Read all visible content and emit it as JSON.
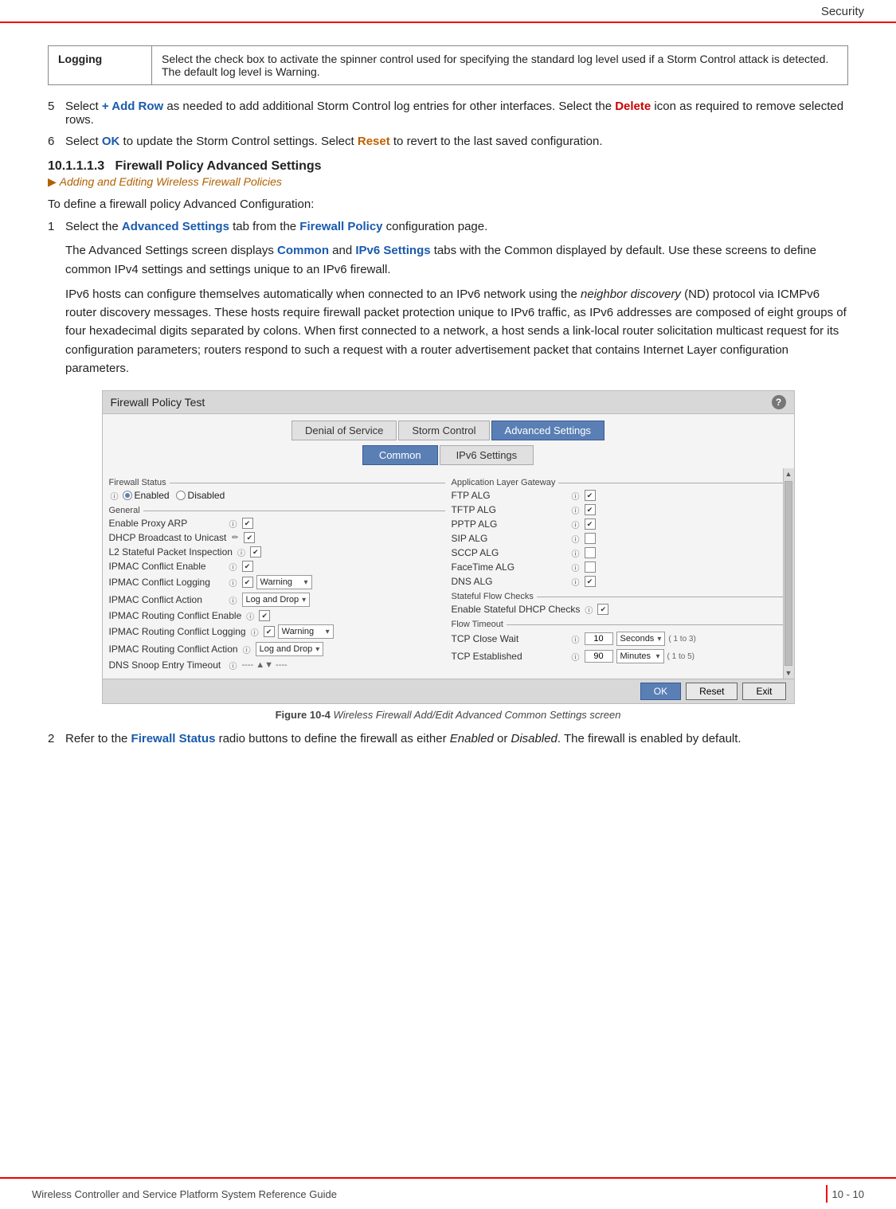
{
  "header": {
    "title": "Security"
  },
  "logging_row": {
    "label": "Logging",
    "description": "Select the check box to activate the spinner control used for specifying the standard log level used if a Storm Control attack is detected. The default log level is Warning."
  },
  "steps": [
    {
      "num": "5",
      "text_parts": [
        {
          "text": "Select ",
          "style": "normal"
        },
        {
          "text": "+ Add Row",
          "style": "blue"
        },
        {
          "text": " as needed to add additional Storm Control log entries for other interfaces. Select the ",
          "style": "normal"
        },
        {
          "text": "Delete",
          "style": "red"
        },
        {
          "text": " icon as required to remove selected rows.",
          "style": "normal"
        }
      ]
    },
    {
      "num": "6",
      "text_parts": [
        {
          "text": "Select ",
          "style": "normal"
        },
        {
          "text": "OK",
          "style": "blue"
        },
        {
          "text": " to update the Storm Control settings. Select ",
          "style": "normal"
        },
        {
          "text": "Reset",
          "style": "orange"
        },
        {
          "text": " to revert to the last saved configuration.",
          "style": "normal"
        }
      ]
    }
  ],
  "section": {
    "number": "10.1.1.1.3",
    "title": "Firewall Policy Advanced Settings",
    "link": "Adding and Editing Wireless Firewall Policies"
  },
  "intro_text": "To define a firewall policy Advanced Configuration:",
  "step1_intro": {
    "num": "1",
    "text_parts": [
      {
        "text": "Select the ",
        "style": "normal"
      },
      {
        "text": "Advanced Settings",
        "style": "blue"
      },
      {
        "text": " tab from the ",
        "style": "normal"
      },
      {
        "text": "Firewall Policy",
        "style": "blue"
      },
      {
        "text": " configuration page.",
        "style": "normal"
      }
    ]
  },
  "para1": "The Advanced Settings screen displays Common and IPv6 Settings tabs with the Common displayed by default. Use these screens to define common IPv4 settings and settings unique to an IPv6 firewall.",
  "para1_highlights": [
    {
      "text": "Common",
      "style": "blue"
    },
    {
      "text": "IPv6 Settings",
      "style": "blue"
    }
  ],
  "para2": "IPv6 hosts can configure themselves automatically when connected to an IPv6 network using the neighbor discovery (ND) protocol via ICMPv6 router discovery messages. These hosts require firewall packet protection unique to IPv6 traffic, as IPv6 addresses are composed of eight groups of four hexadecimal digits separated by colons. When first connected to a network, a host sends a link-local router solicitation multicast request for its configuration parameters; routers respond to such a request with a router advertisement packet that contains Internet Layer configuration parameters.",
  "screenshot": {
    "title": "Firewall Policy  Test",
    "tabs": [
      "Denial of Service",
      "Storm Control",
      "Advanced Settings"
    ],
    "active_tab": "Advanced Settings",
    "subtabs": [
      "Common",
      "IPv6 Settings"
    ],
    "active_subtab": "Common",
    "left_column": {
      "firewall_status_label": "Firewall Status",
      "enabled_label": "Enabled",
      "disabled_label": "Disabled",
      "general_label": "General",
      "fields": [
        {
          "label": "Enable Proxy ARP",
          "has_icon": true,
          "checked": true
        },
        {
          "label": "DHCP Broadcast to Unicast",
          "has_icon": true,
          "checked": true
        },
        {
          "label": "L2 Stateful Packet Inspection",
          "has_icon": true,
          "checked": true
        },
        {
          "label": "IPMAC Conflict Enable",
          "has_icon": true,
          "checked": true
        },
        {
          "label": "IPMAC Conflict Logging",
          "has_icon": true,
          "checked": true,
          "dropdown": "Warning"
        },
        {
          "label": "IPMAC Conflict Action",
          "has_icon": true,
          "dropdown": "Log and Drop"
        },
        {
          "label": "IPMAC Routing Conflict Enable",
          "has_icon": true,
          "checked": true
        },
        {
          "label": "IPMAC Routing Conflict Logging",
          "has_icon": true,
          "checked": true,
          "dropdown": "Warning"
        },
        {
          "label": "IPMAC Routing Conflict Action",
          "has_icon": true,
          "dropdown": "Log and Drop"
        },
        {
          "label": "DNS Snoop Entry Timeout",
          "has_icon": true,
          "has_spinners": true
        }
      ]
    },
    "right_column": {
      "alg_label": "Application Layer Gateway",
      "alg_fields": [
        {
          "label": "FTP ALG",
          "has_icon": true,
          "checked": true
        },
        {
          "label": "TFTP ALG",
          "has_icon": true,
          "checked": true
        },
        {
          "label": "PPTP ALG",
          "has_icon": true,
          "checked": true
        },
        {
          "label": "SIP ALG",
          "has_icon": true,
          "checked": false
        },
        {
          "label": "SCCP ALG",
          "has_icon": true,
          "checked": false
        },
        {
          "label": "FaceTime ALG",
          "has_icon": true,
          "checked": false
        },
        {
          "label": "DNS ALG",
          "has_icon": true,
          "checked": true
        }
      ],
      "stateful_flow_label": "Stateful Flow Checks",
      "stateful_fields": [
        {
          "label": "Enable Stateful DHCP Checks",
          "has_icon": true,
          "checked": true
        }
      ],
      "flow_timeout_label": "Flow Timeout",
      "flow_fields": [
        {
          "label": "TCP Close Wait",
          "has_icon": true,
          "value": "10",
          "dropdown": "Seconds",
          "range": "( 1 to 3)"
        },
        {
          "label": "TCP Established",
          "has_icon": true,
          "value": "90",
          "dropdown": "Minutes",
          "range": "( 1 to 5)"
        }
      ]
    },
    "footer_buttons": [
      "OK",
      "Reset",
      "Exit"
    ]
  },
  "figure_caption": {
    "bold": "Figure 10-4",
    "italic": " Wireless Firewall Add/Edit Advanced Common Settings screen"
  },
  "step2": {
    "num": "2",
    "text_parts": [
      {
        "text": "Refer to the ",
        "style": "normal"
      },
      {
        "text": "Firewall Status",
        "style": "blue"
      },
      {
        "text": " radio buttons to define the firewall as either ",
        "style": "normal"
      },
      {
        "text": "Enabled",
        "style": "italic"
      },
      {
        "text": " or ",
        "style": "normal"
      },
      {
        "text": "Disabled",
        "style": "italic"
      },
      {
        "text": ". The firewall is enabled by default.",
        "style": "normal"
      }
    ]
  },
  "footer": {
    "left": "Wireless Controller and Service Platform System Reference Guide",
    "right_page": "10 - 10"
  }
}
